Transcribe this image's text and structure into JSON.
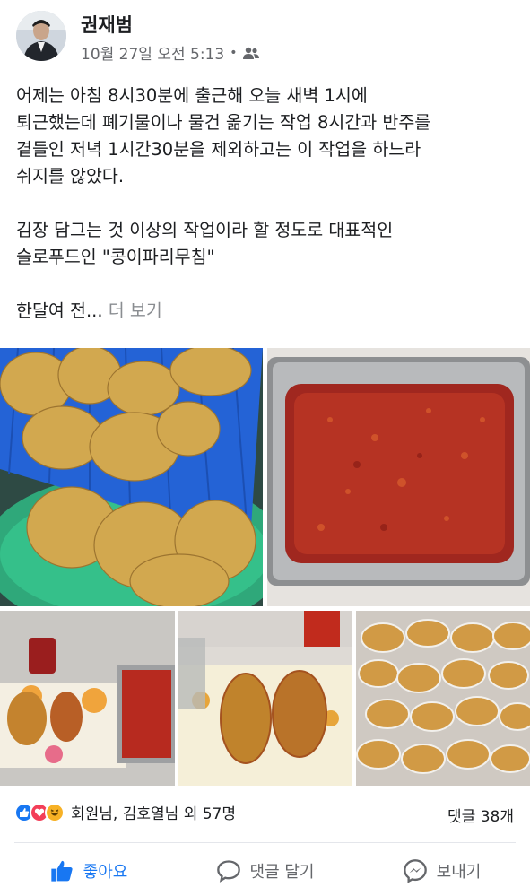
{
  "author": {
    "name": "권재범",
    "timestamp": "10월 27일 오전 5:13",
    "separator": "•",
    "audience_icon": "friends-icon"
  },
  "post": {
    "paragraphs": [
      [
        "어제는 아침 8시30분에 출근해 오늘 새벽 1시에",
        "퇴근했는데 폐기물이나 물건 옮기는 작업 8시간과 반주를",
        "곁들인 저녁 1시간30분을 제외하고는 이 작업을 하느라",
        "쉬지를 않았다."
      ],
      [
        "김장 담그는 것 이상의 작업이라 할 정도로 대표적인",
        "슬로푸드인 \"콩이파리무침\""
      ]
    ],
    "truncated_text": "한달여 전...",
    "see_more": "더 보기"
  },
  "photos": [
    {
      "subject": "dried yellow soybean leaves in blue basket"
    },
    {
      "subject": "red chili seasoning in steel tray"
    },
    {
      "subject": "seasoned leaves on tray with sauce"
    },
    {
      "subject": "seasoned leaf bundles close-up"
    },
    {
      "subject": "packed bags of seasoned leaves"
    }
  ],
  "reactions": {
    "icons": [
      "like-reaction-icon",
      "love-reaction-icon",
      "haha-reaction-icon"
    ],
    "summary": "회원님, 김호열님 외 57명",
    "comments": "댓글 38개"
  },
  "actions": {
    "like": "좋아요",
    "comment": "댓글 달기",
    "share": "보내기"
  },
  "colors": {
    "accent": "#1877f2",
    "secondary_text": "#65676b",
    "see_more": "#8a8d91"
  }
}
